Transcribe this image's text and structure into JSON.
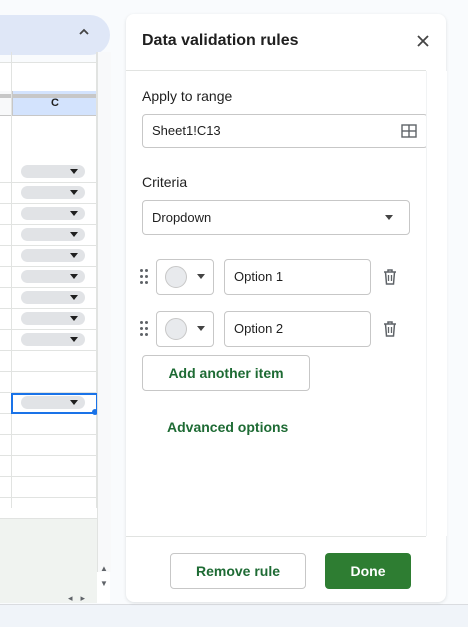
{
  "sheet": {
    "column_header": "C",
    "dropdown_rows": 9
  },
  "panel": {
    "title": "Data validation rules",
    "apply_to_range_label": "Apply to range",
    "range_value": "Sheet1!C13",
    "criteria_label": "Criteria",
    "criteria_value": "Dropdown",
    "options": [
      {
        "value": "Option 1"
      },
      {
        "value": "Option 2"
      }
    ],
    "add_item_label": "Add another item",
    "advanced_label": "Advanced options",
    "remove_label": "Remove rule",
    "done_label": "Done"
  },
  "colors": {
    "accent_green": "#2e7d32",
    "link_green": "#1e6b34",
    "selection_blue": "#1a73e8",
    "header_highlight": "#d3e3fd"
  }
}
